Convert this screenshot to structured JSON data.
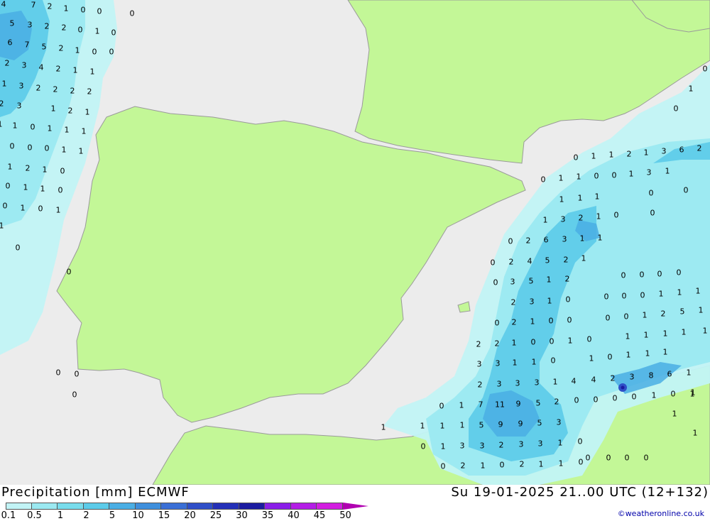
{
  "title": "Precipitation [mm] ECMWF",
  "run_info": "Su 19-01-2025 21..00 UTC (12+132)",
  "credit": "©weatheronline.co.uk",
  "colors": {
    "sea": "#ececec",
    "land": "#c3f797",
    "border": "#9a9a9a",
    "precip": [
      "#c2f4f6",
      "#9be9f1",
      "#78dcec",
      "#5ccbe9",
      "#4aaee4",
      "#3f8fdc",
      "#3a6fd6",
      "#2f4fc8",
      "#2430b8",
      "#1c1ca0",
      "#8a1ee8",
      "#b41ee6",
      "#d21ee0",
      "#e61edc",
      "#b41eb0"
    ]
  },
  "legend": {
    "labels": [
      "0.1",
      "0.5",
      "1",
      "2",
      "5",
      "10",
      "15",
      "20",
      "25",
      "30",
      "35",
      "40",
      "45",
      "50"
    ]
  },
  "values": [
    "4",
    "7",
    "2",
    "1",
    "0",
    "0",
    "0",
    "5",
    "3",
    "2",
    "2",
    "0",
    "1",
    "0",
    "6",
    "7",
    "5",
    "2",
    "1",
    "0",
    "0",
    "2",
    "3",
    "4",
    "2",
    "1",
    "1",
    "1",
    "3",
    "2",
    "2",
    "2",
    "2",
    "2",
    "3",
    "1",
    "2",
    "1",
    "1",
    "1",
    "0",
    "1",
    "1",
    "1",
    "0",
    "0",
    "0",
    "1",
    "1",
    "1",
    "2",
    "1",
    "0",
    "0",
    "1",
    "1",
    "0",
    "0",
    "1",
    "0",
    "1",
    "1",
    "0",
    "0",
    "0",
    "0",
    "0",
    "0",
    "1",
    "1",
    "2",
    "1",
    "3",
    "6",
    "2",
    "0",
    "1",
    "1",
    "0",
    "0",
    "1",
    "3",
    "1",
    "0",
    "0",
    "0",
    "1",
    "0",
    "1",
    "1",
    "1",
    "1",
    "3",
    "2",
    "1",
    "0",
    "0",
    "2",
    "6",
    "3",
    "1",
    "1",
    "0",
    "2",
    "4",
    "5",
    "2",
    "1",
    "0",
    "3",
    "5",
    "1",
    "2",
    "0",
    "0",
    "0",
    "0",
    "0",
    "2",
    "3",
    "1",
    "0",
    "0",
    "0",
    "0",
    "1",
    "1",
    "1",
    "0",
    "2",
    "1",
    "0",
    "0",
    "0",
    "0",
    "1",
    "2",
    "5",
    "1",
    "2",
    "2",
    "1",
    "0",
    "0",
    "1",
    "0",
    "1",
    "1",
    "1",
    "1",
    "1",
    "3",
    "3",
    "1",
    "1",
    "0",
    "1",
    "0",
    "1",
    "1",
    "1",
    "2",
    "3",
    "3",
    "3",
    "1",
    "4",
    "4",
    "2",
    "3",
    "8",
    "6",
    "1",
    "0",
    "1",
    "7",
    "11",
    "9",
    "5",
    "2",
    "0",
    "0",
    "0",
    "0",
    "1",
    "0",
    "1",
    "1",
    "1",
    "1",
    "5",
    "9",
    "9",
    "5",
    "3",
    "0",
    "1",
    "3",
    "3",
    "2",
    "3",
    "3",
    "1",
    "0",
    "0",
    "2",
    "1",
    "0",
    "2",
    "1",
    "1",
    "0",
    "1",
    "1",
    "1",
    "1",
    "0",
    "0",
    "0",
    "0",
    "0",
    "0"
  ]
}
